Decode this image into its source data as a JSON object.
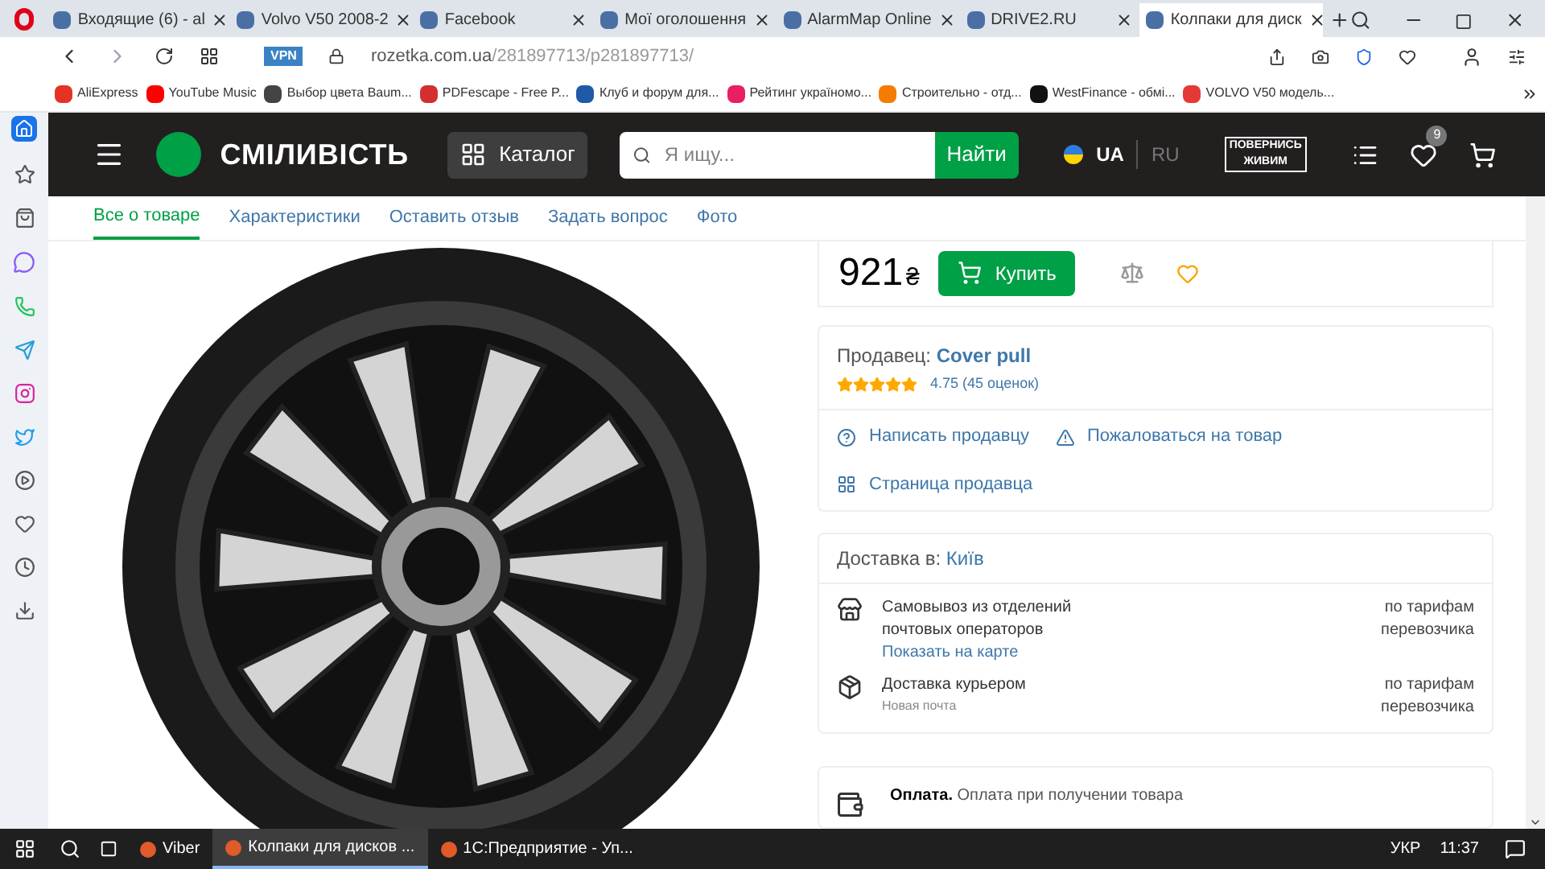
{
  "browser_tabs": [
    {
      "title": "Входящие (6) - al",
      "selected": false
    },
    {
      "title": "Volvo V50 2008-2",
      "selected": false
    },
    {
      "title": "Facebook",
      "selected": false
    },
    {
      "title": "Мої оголошення",
      "selected": false
    },
    {
      "title": "AlarmMap Online",
      "selected": false
    },
    {
      "title": "DRIVE2.RU",
      "selected": false
    },
    {
      "title": "Колпаки для диск",
      "selected": true
    }
  ],
  "address_bar": {
    "vpn": "VPN",
    "host": "rozetka.com.ua",
    "path": "/281897713/p281897713/"
  },
  "bookmarks": [
    {
      "label": "AliExpress",
      "color": "#e43225"
    },
    {
      "label": "YouTube Music",
      "color": "#ff0000"
    },
    {
      "label": "Выбор цвета Baum...",
      "color": "#444444"
    },
    {
      "label": "PDFescape - Free P...",
      "color": "#d32f2f"
    },
    {
      "label": "Клуб и форум для...",
      "color": "#1e5aa8"
    },
    {
      "label": "Рейтинг україномо...",
      "color": "#e91e63"
    },
    {
      "label": "Строительно - отд...",
      "color": "#f57c00"
    },
    {
      "label": "WestFinance - обмі...",
      "color": "#111111"
    },
    {
      "label": "VOLVO V50 модель...",
      "color": "#e53935"
    }
  ],
  "site_header": {
    "logo": "СМІЛИВІСТЬ",
    "catalog": "Каталог",
    "search": {
      "placeholder": "Я ищу..."
    },
    "search_button": "Найти",
    "languages": [
      {
        "label": "UA",
        "selected": true
      },
      {
        "label": "RU",
        "selected": false
      }
    ],
    "badge": "ПОВЕРНИСЬ ЖИВИМ",
    "wishlist_count": "9"
  },
  "product_tabs": [
    {
      "label": "Все о товаре",
      "selected": true
    },
    {
      "label": "Характеристики",
      "selected": false
    },
    {
      "label": "Оставить отзыв",
      "selected": false
    },
    {
      "label": "Задать вопрос",
      "selected": false
    },
    {
      "label": "Фото",
      "selected": false
    }
  ],
  "price": {
    "amount": "921",
    "currency": "₴",
    "buy": "Купить"
  },
  "seller": {
    "label": "Продавец:",
    "name": "Cover pull",
    "stars": 5,
    "rating": "4.75",
    "reviews": "(45 оценок)",
    "links": [
      "Написать продавцу",
      "Пожаловаться на товар",
      "Страница продавца"
    ]
  },
  "delivery": {
    "label": "Доставка в:",
    "city": "Київ",
    "options": [
      {
        "kind": "pickup",
        "title": "Самовывоз из отделений почтовых операторов",
        "link": "Показать на карте",
        "price": "по тарифам перевозчика"
      },
      {
        "kind": "courier",
        "title": "Доставка курьером",
        "note": "Новая почта",
        "price": "по тарифам перевозчика"
      }
    ]
  },
  "payment": {
    "title": "Оплата.",
    "text": "Оплата при получении товара"
  },
  "taskbar": {
    "apps": [
      {
        "label": "Viber",
        "selected": false
      },
      {
        "label": "Колпаки для дисков ...",
        "selected": true
      },
      {
        "label": "1С:Предприятие - Уп...",
        "selected": false
      }
    ],
    "language": "УКР",
    "time": "11:37"
  }
}
